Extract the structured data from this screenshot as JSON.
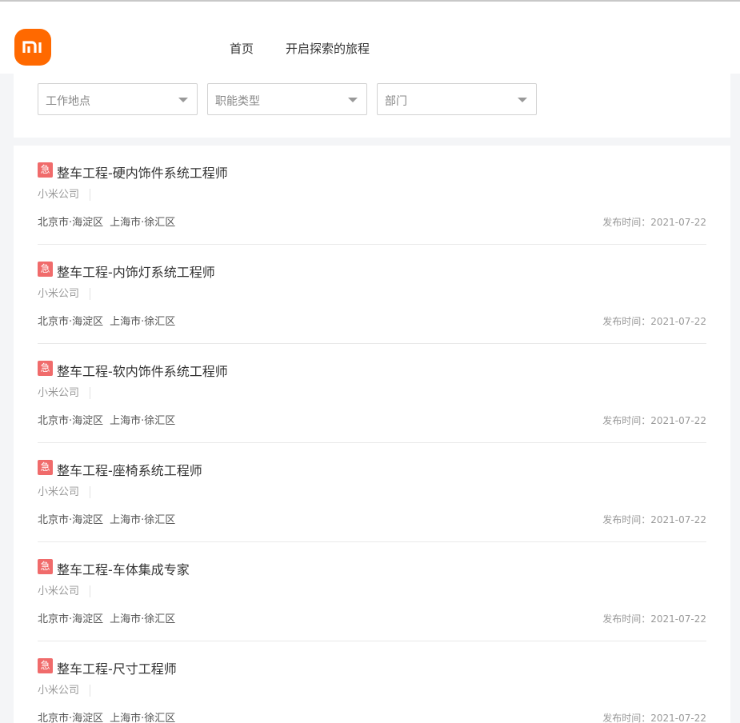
{
  "header": {
    "logo_text": "mi",
    "nav": [
      "首页",
      "开启探索的旅程"
    ]
  },
  "filters": {
    "location_placeholder": "工作地点",
    "category_placeholder": "职能类型",
    "department_placeholder": "部门"
  },
  "colors": {
    "brand": "#ff6900",
    "urgent": "#f06b6b"
  },
  "jobs": [
    {
      "urgent_label": "急",
      "title": "整车工程-硬内饰件系统工程师",
      "company": "小米公司",
      "locations": [
        "北京市·海淀区",
        "上海市·徐汇区"
      ],
      "date": "发布时间：2021-07-22"
    },
    {
      "urgent_label": "急",
      "title": "整车工程-内饰灯系统工程师",
      "company": "小米公司",
      "locations": [
        "北京市·海淀区",
        "上海市·徐汇区"
      ],
      "date": "发布时间：2021-07-22"
    },
    {
      "urgent_label": "急",
      "title": "整车工程-软内饰件系统工程师",
      "company": "小米公司",
      "locations": [
        "北京市·海淀区",
        "上海市·徐汇区"
      ],
      "date": "发布时间：2021-07-22"
    },
    {
      "urgent_label": "急",
      "title": "整车工程-座椅系统工程师",
      "company": "小米公司",
      "locations": [
        "北京市·海淀区",
        "上海市·徐汇区"
      ],
      "date": "发布时间：2021-07-22"
    },
    {
      "urgent_label": "急",
      "title": "整车工程-车体集成专家",
      "company": "小米公司",
      "locations": [
        "北京市·海淀区",
        "上海市·徐汇区"
      ],
      "date": "发布时间：2021-07-22"
    },
    {
      "urgent_label": "急",
      "title": "整车工程-尺寸工程师",
      "company": "小米公司",
      "locations": [
        "北京市·海淀区",
        "上海市·徐汇区"
      ],
      "date": "发布时间：2021-07-22"
    }
  ]
}
